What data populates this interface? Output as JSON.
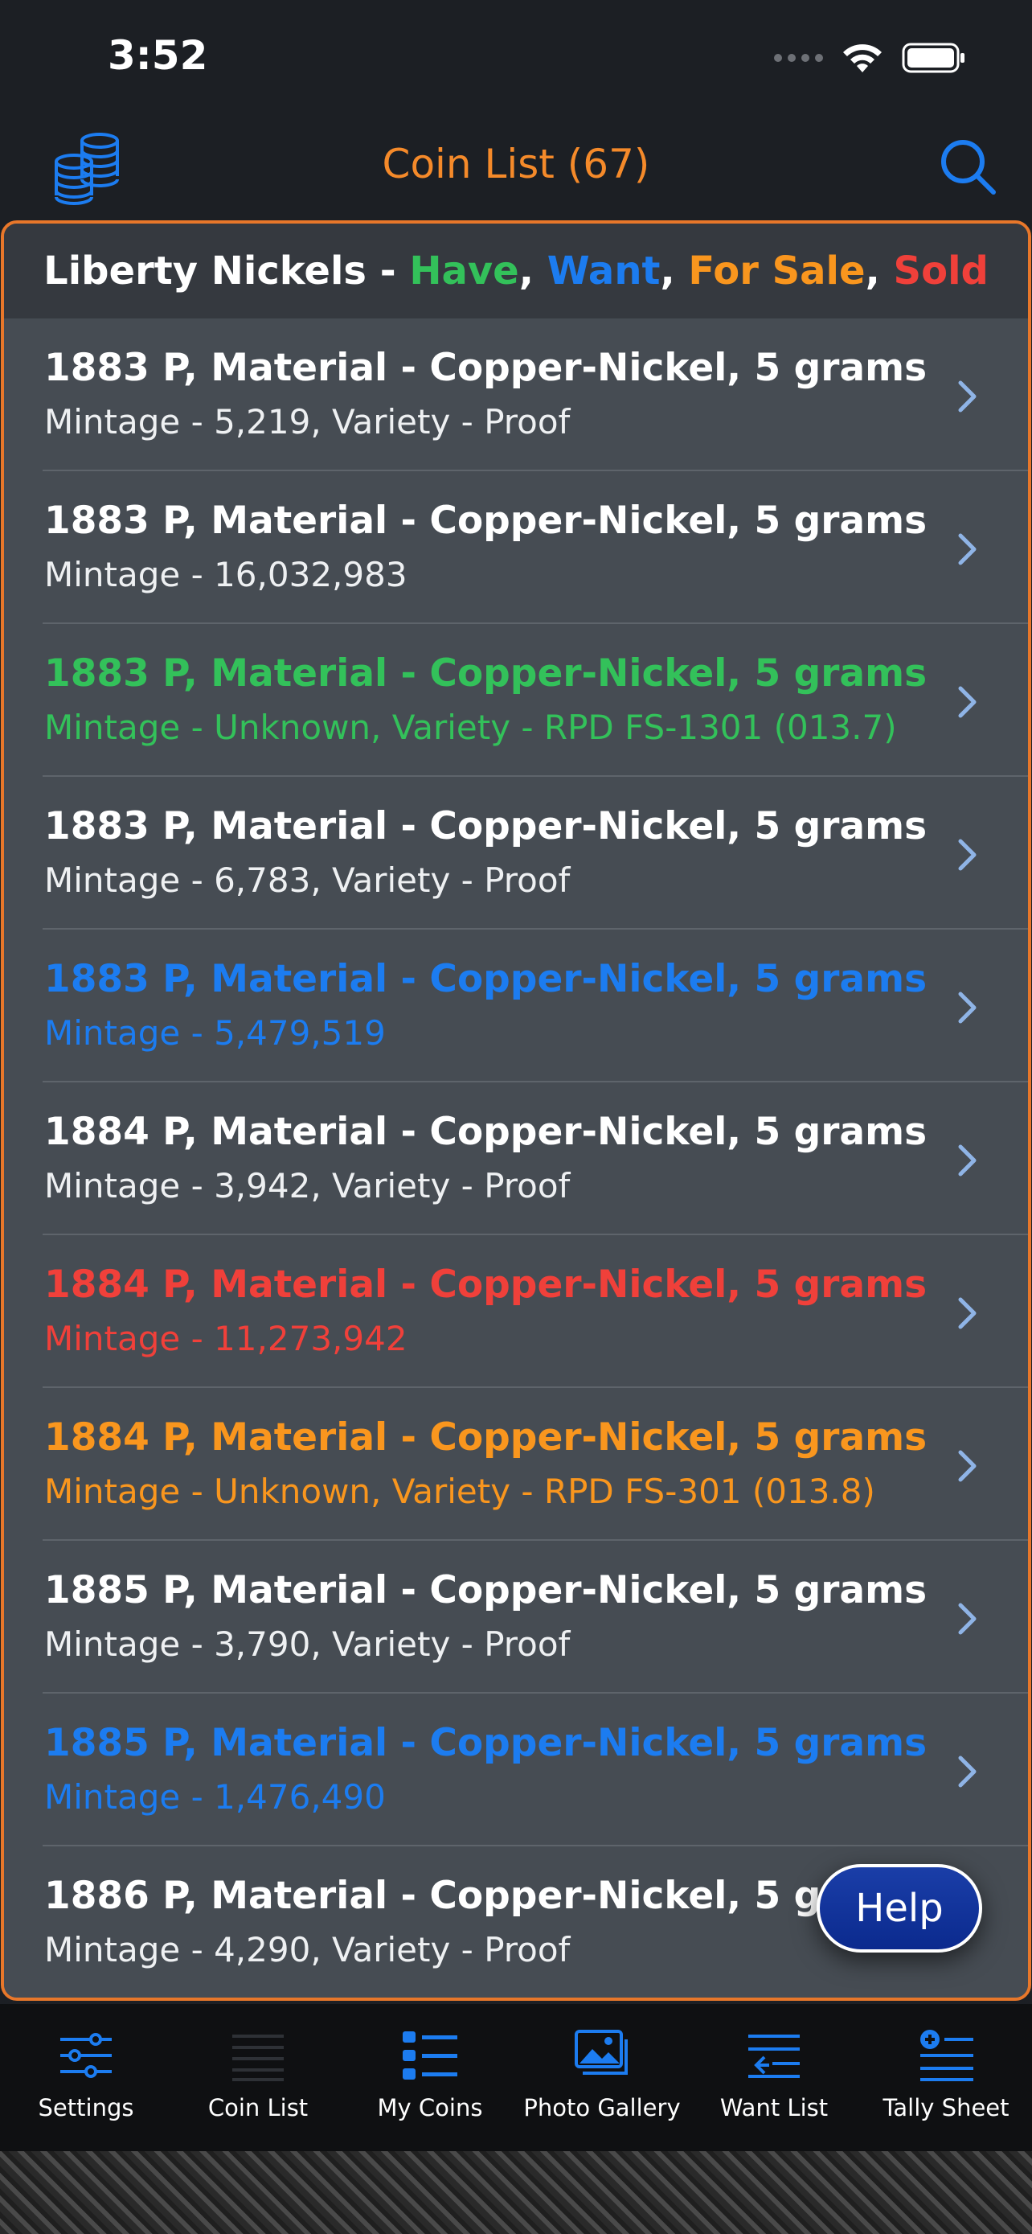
{
  "status_bar": {
    "time": "3:52"
  },
  "nav": {
    "title": "Coin List (67)"
  },
  "list_header": {
    "prefix": "Liberty Nickels - ",
    "have": "Have",
    "want": "Want",
    "for_sale": "For Sale",
    "sold": "Sold",
    "comma": ", "
  },
  "colors": {
    "accent_orange": "#f58a2a",
    "have": "#33c15a",
    "want": "#1c7cf0",
    "for_sale": "#f9961e",
    "sold": "#f0403a",
    "help_button": "#0b2a8e"
  },
  "rows": [
    {
      "title": "1883 P, Material - Copper-Nickel, 5 grams",
      "subtitle": "Mintage - 5,219, Variety - Proof",
      "status": "none"
    },
    {
      "title": "1883 P, Material - Copper-Nickel, 5 grams",
      "subtitle": "Mintage - 16,032,983",
      "status": "none"
    },
    {
      "title": "1883 P, Material - Copper-Nickel, 5 grams",
      "subtitle": "Mintage - Unknown, Variety - RPD FS-1301 (013.7)",
      "status": "have"
    },
    {
      "title": "1883 P, Material - Copper-Nickel, 5 grams",
      "subtitle": "Mintage - 6,783, Variety - Proof",
      "status": "none"
    },
    {
      "title": "1883 P, Material - Copper-Nickel, 5 grams",
      "subtitle": "Mintage - 5,479,519",
      "status": "want"
    },
    {
      "title": "1884 P, Material - Copper-Nickel, 5 grams",
      "subtitle": "Mintage - 3,942, Variety - Proof",
      "status": "none"
    },
    {
      "title": "1884 P, Material - Copper-Nickel, 5 grams",
      "subtitle": "Mintage - 11,273,942",
      "status": "sold"
    },
    {
      "title": "1884 P, Material - Copper-Nickel, 5 grams",
      "subtitle": "Mintage - Unknown, Variety - RPD FS-301 (013.8)",
      "status": "for_sale"
    },
    {
      "title": "1885 P, Material - Copper-Nickel, 5 grams",
      "subtitle": "Mintage - 3,790, Variety - Proof",
      "status": "none"
    },
    {
      "title": "1885 P, Material - Copper-Nickel, 5 grams",
      "subtitle": "Mintage - 1,476,490",
      "status": "want"
    },
    {
      "title": "1886 P, Material - Copper-Nickel, 5 grams",
      "subtitle": "Mintage - 4,290, Variety - Proof",
      "status": "none"
    }
  ],
  "help_button": {
    "label": "Help"
  },
  "tabs": [
    {
      "label": "Settings",
      "icon": "sliders-icon"
    },
    {
      "label": "Coin List",
      "icon": "list-lines-icon"
    },
    {
      "label": "My Coins",
      "icon": "bulleted-list-icon"
    },
    {
      "label": "Photo Gallery",
      "icon": "photo-gallery-icon"
    },
    {
      "label": "Want List",
      "icon": "want-list-icon"
    },
    {
      "label": "Tally Sheet",
      "icon": "tally-add-icon"
    }
  ]
}
